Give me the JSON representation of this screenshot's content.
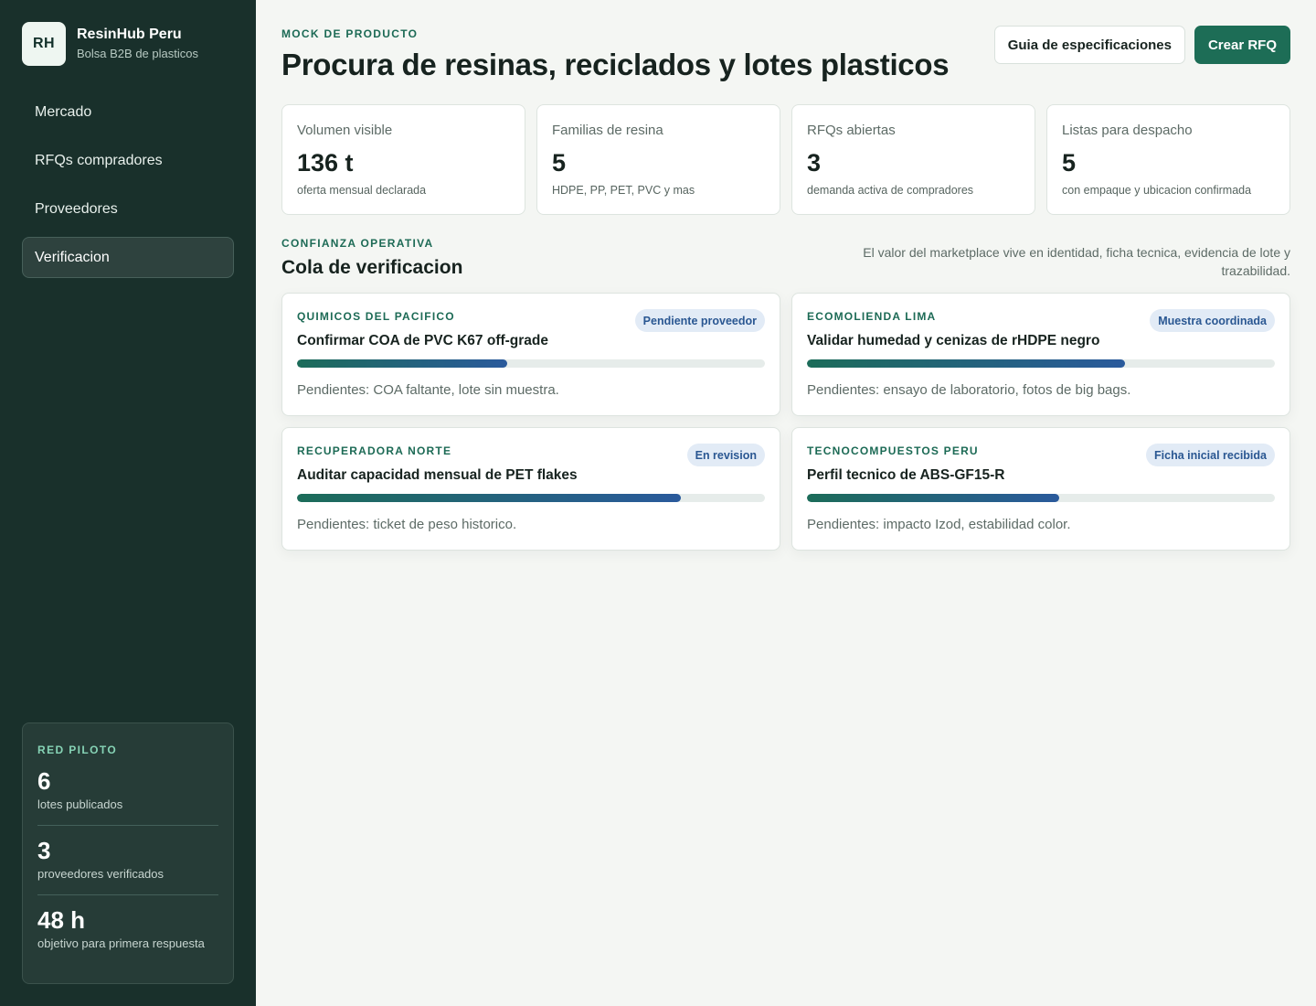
{
  "brand": {
    "logo": "RH",
    "name": "ResinHub Peru",
    "subtitle": "Bolsa B2B de plasticos"
  },
  "nav": {
    "items": [
      {
        "label": "Mercado",
        "active": false
      },
      {
        "label": "RFQs compradores",
        "active": false
      },
      {
        "label": "Proveedores",
        "active": false
      },
      {
        "label": "Verificacion",
        "active": true
      }
    ]
  },
  "pilot": {
    "title": "RED PILOTO",
    "stats": [
      {
        "value": "6",
        "label": "lotes publicados"
      },
      {
        "value": "3",
        "label": "proveedores verificados"
      },
      {
        "value": "48 h",
        "label": "objetivo para primera respuesta"
      }
    ]
  },
  "header": {
    "eyebrow": "MOCK DE PRODUCTO",
    "title": "Procura de resinas, reciclados y lotes plasticos",
    "secondary_button": "Guia de especificaciones",
    "primary_button": "Crear RFQ"
  },
  "stats": [
    {
      "label": "Volumen visible",
      "value": "136 t",
      "note": "oferta mensual declarada"
    },
    {
      "label": "Familias de resina",
      "value": "5",
      "note": "HDPE, PP, PET, PVC y mas"
    },
    {
      "label": "RFQs abiertas",
      "value": "3",
      "note": "demanda activa de compradores"
    },
    {
      "label": "Listas para despacho",
      "value": "5",
      "note": "con empaque y ubicacion confirmada"
    }
  ],
  "section": {
    "eyebrow": "CONFIANZA OPERATIVA",
    "title": "Cola de verificacion",
    "description": "El valor del marketplace vive en identidad, ficha tecnica, evidencia de lote y trazabilidad."
  },
  "verification": [
    {
      "company": "QUIMICOS DEL PACIFICO",
      "task": "Confirmar COA de PVC K67 off-grade",
      "status": "Pendiente proveedor",
      "progress": 0.45,
      "pending": "Pendientes: COA faltante, lote sin muestra."
    },
    {
      "company": "ECOMOLIENDA LIMA",
      "task": "Validar humedad y cenizas de rHDPE negro",
      "status": "Muestra coordinada",
      "progress": 0.68,
      "pending": "Pendientes: ensayo de laboratorio, fotos de big bags."
    },
    {
      "company": "RECUPERADORA NORTE",
      "task": "Auditar capacidad mensual de PET flakes",
      "status": "En revision",
      "progress": 0.82,
      "pending": "Pendientes: ticket de peso historico."
    },
    {
      "company": "TECNOCOMPUESTOS PERU",
      "task": "Perfil tecnico de ABS-GF15-R",
      "status": "Ficha inicial recibida",
      "progress": 0.54,
      "pending": "Pendientes: impacto Izod, estabilidad color."
    }
  ]
}
